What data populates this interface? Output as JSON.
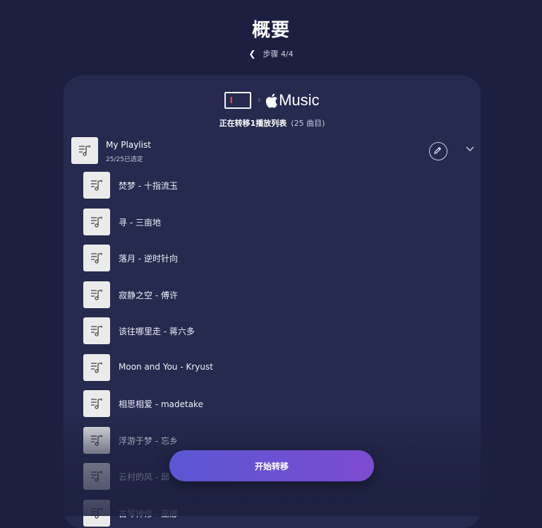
{
  "header": {
    "title": "概要",
    "step": "步骤 4/4"
  },
  "card": {
    "source_icon": "text-cursor-icon",
    "dest_icon": "apple-icon",
    "dest_label": "Music",
    "transfer_text": "正在转移1播放列表",
    "transfer_count": "(25 曲目)"
  },
  "playlist": {
    "name": "My Playlist",
    "selected": "25/25已选定",
    "songs": [
      {
        "title": "焚梦 - 十指流玉"
      },
      {
        "title": "寻 - 三亩地"
      },
      {
        "title": "落月 - 逆时针向"
      },
      {
        "title": "寂静之空 - 傅许"
      },
      {
        "title": "该往哪里走 - 蒋六多"
      },
      {
        "title": "Moon and You - Kryust"
      },
      {
        "title": "相思相爱 - madetake"
      },
      {
        "title": "浮游于梦 - 忘乡"
      },
      {
        "title": "云村的风 - 邱"
      },
      {
        "title": "古琴禅修 - 巫娜"
      }
    ]
  },
  "actions": {
    "start_label": "开始转移"
  },
  "colors": {
    "background": "#1c1f3f",
    "card": "#262a4e",
    "button_start": "#5a57d3",
    "button_end": "#7d4bd0"
  }
}
